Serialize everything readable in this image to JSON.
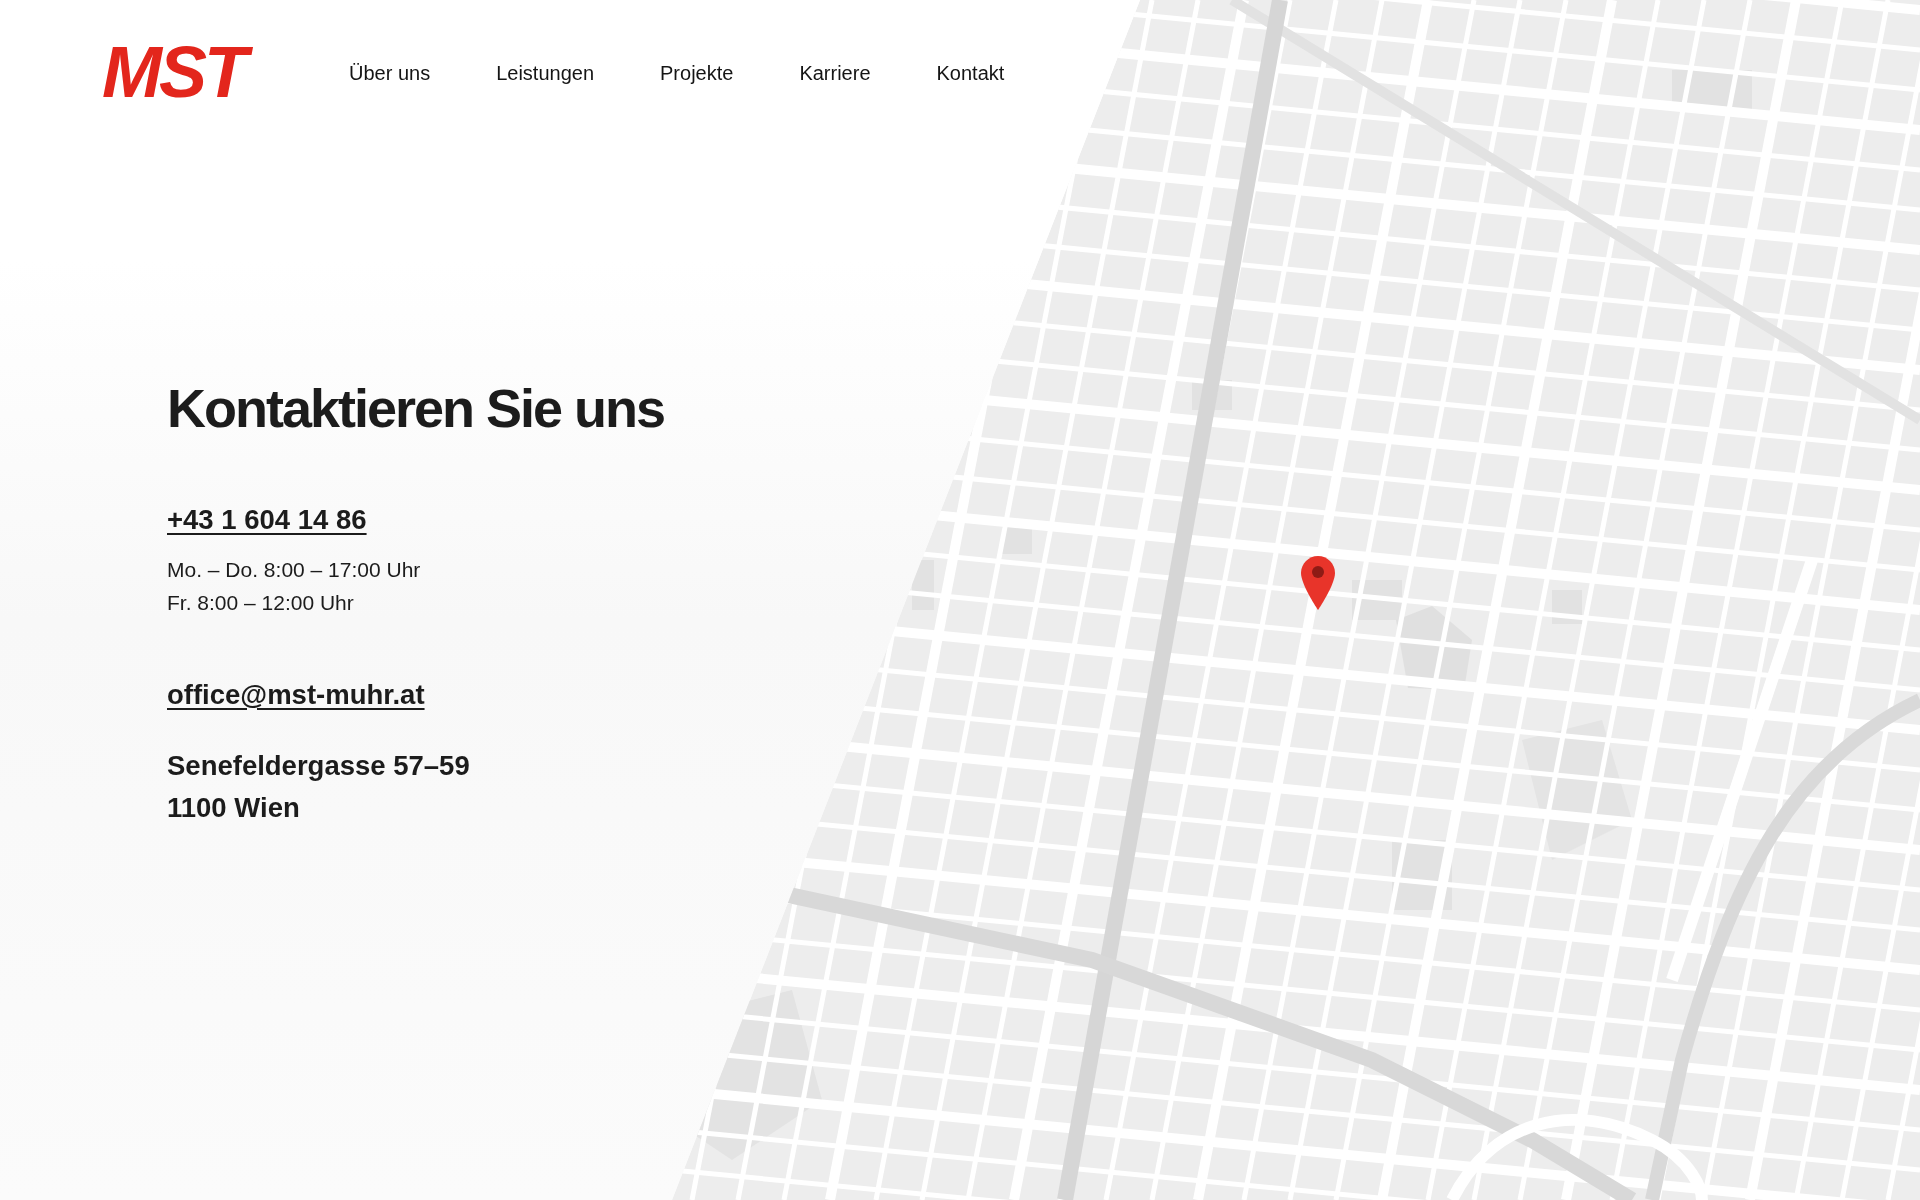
{
  "logo": {
    "text": "MST"
  },
  "nav": {
    "items": [
      {
        "label": "Über uns"
      },
      {
        "label": "Leistungen"
      },
      {
        "label": "Projekte"
      },
      {
        "label": "Karriere"
      },
      {
        "label": "Kontakt"
      }
    ]
  },
  "contact": {
    "title": "Kontaktieren Sie uns",
    "phone": "+43 1 604 14 86",
    "hours": [
      "Mo. – Do. 8:00 – 17:00 Uhr",
      "Fr. 8:00 – 12:00 Uhr"
    ],
    "email": "office@mst-muhr.at",
    "address": [
      "Senefeldergasse 57–59",
      "1100 Wien"
    ]
  }
}
